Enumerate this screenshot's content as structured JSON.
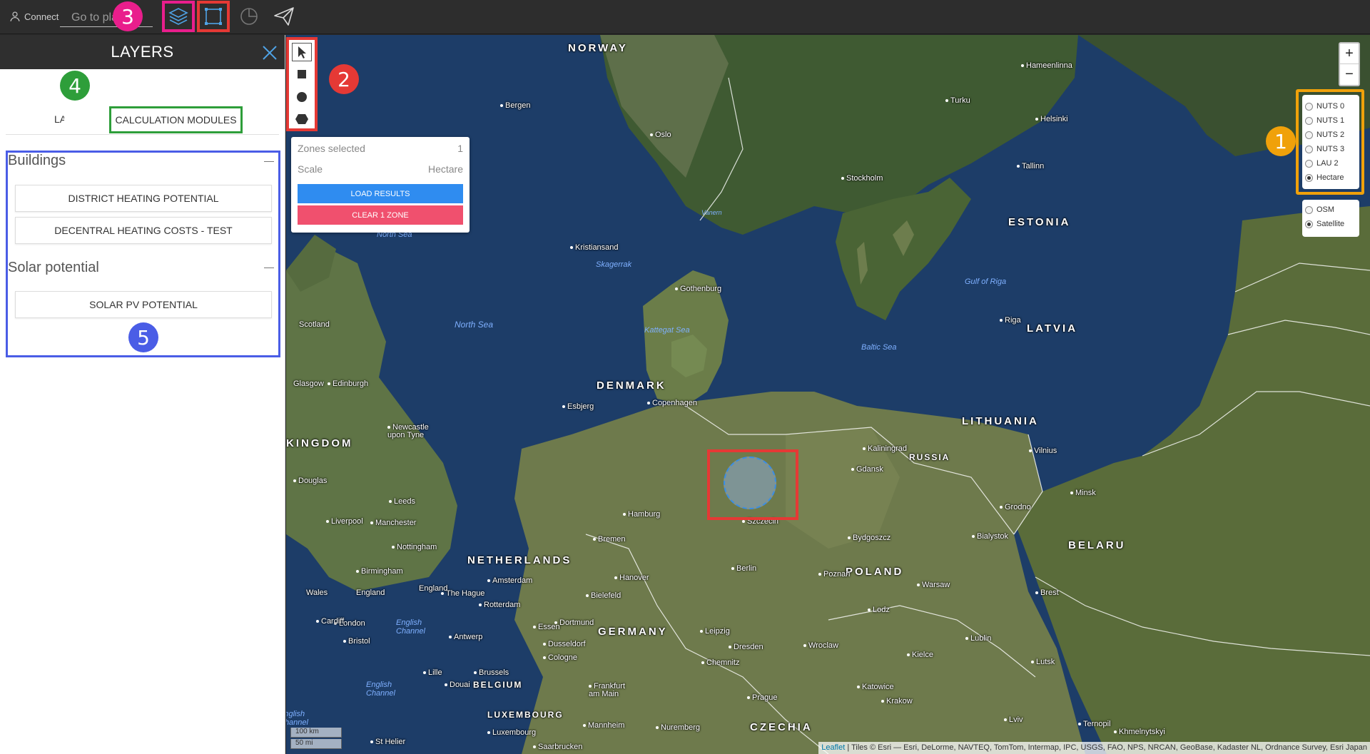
{
  "topbar": {
    "connect_label": "Connect",
    "goto_placeholder": "Go to place",
    "icons": [
      "user-icon",
      "layers-icon",
      "selection-icon",
      "pie-chart-icon",
      "send-icon"
    ]
  },
  "badges": {
    "one": "1",
    "two": "2",
    "three": "3",
    "four": "4",
    "five": "5"
  },
  "panel": {
    "title": "LAYERS",
    "tab_layers": "LAYERS",
    "tab_calc": "CALCULATION MODULES",
    "groups": [
      {
        "title": "Buildings",
        "modules": [
          "DISTRICT HEATING POTENTIAL",
          "DECENTRAL HEATING COSTS - TEST"
        ]
      },
      {
        "title": "Solar potential",
        "modules": [
          "SOLAR PV POTENTIAL"
        ]
      }
    ]
  },
  "selection": {
    "zones_label": "Zones selected",
    "zones_value": "1",
    "scale_label": "Scale",
    "scale_value": "Hectare",
    "load_btn": "LOAD RESULTS",
    "clear_btn": "CLEAR 1 ZONE"
  },
  "zoom": {
    "in": "+",
    "out": "−"
  },
  "levels": {
    "options": [
      "NUTS 0",
      "NUTS 1",
      "NUTS 2",
      "NUTS 3",
      "LAU 2",
      "Hectare"
    ],
    "selected": "Hectare"
  },
  "basemaps": {
    "options": [
      "OSM",
      "Satellite"
    ],
    "selected": "Satellite"
  },
  "scale": {
    "km": "100 km",
    "mi": "50 mi"
  },
  "attribution": {
    "leaflet": "Leaflet",
    "text": " | Tiles © Esri — Esri, DeLorme, NAVTEQ, TomTom, Intermap, IPC, USGS, FAO, NPS, NRCAN, GeoBase, Kadaster NL, Ordnance Survey, Esri Japan"
  },
  "map_labels": {
    "countries": [
      "NORWAY",
      "DENMARK",
      "NETHERLANDS",
      "GERMANY",
      "POLAND",
      "LITHUANIA",
      "LATVIA",
      "ESTONIA",
      "RUSSIA",
      "BELGIUM",
      "LUXEMBOURG",
      "CZECHIA",
      "BELARU",
      "KINGDOM"
    ],
    "seas": [
      "North Sea",
      "North Sea",
      "Skagerrak",
      "Kattegat Sea",
      "Baltic Sea",
      "Gulf of Riga",
      "Vanern",
      "English Channel",
      "English Channel",
      "English Channel"
    ],
    "cities": [
      "Bergen",
      "Oslo",
      "Stockholm",
      "Turku",
      "Helsinki",
      "Hameenlinna",
      "Tallinn",
      "Riga",
      "Kristiansand",
      "Gothenburg",
      "Copenhagen",
      "Esbjerg",
      "Hamburg",
      "Bremen",
      "Kaliningrad",
      "Gdansk",
      "Vilnius",
      "Minsk",
      "Grodno",
      "Bialystok",
      "Brest",
      "Szczecin",
      "Bydgoszcz",
      "Berlin",
      "Poznan",
      "Warsaw",
      "Lodz",
      "Lublin",
      "Kielce",
      "Lutsk",
      "Krakow",
      "Katowice",
      "Lviv",
      "Wroclaw",
      "Dresden",
      "Chemnitz",
      "Leipzig",
      "Hanover",
      "Bielefeld",
      "Dortmund",
      "Essen",
      "Dusseldorf",
      "Cologne",
      "Frankfurt am Main",
      "Mannheim",
      "Nuremberg",
      "Saarbrucken",
      "Prague",
      "Amsterdam",
      "The Hague",
      "Rotterdam",
      "Antwerp",
      "Brussels",
      "Lille",
      "Douai",
      "Luxembourg",
      "London",
      "Bristol",
      "Cardiff",
      "Wales",
      "England",
      "England",
      "Birmingham",
      "Nottingham",
      "Liverpool",
      "Manchester",
      "Leeds",
      "Douglas",
      "Newcastle upon Tyne",
      "Edinburgh",
      "Glasgow",
      "Scotland",
      "St Helier",
      "Ternopil",
      "Khmelnytskyi"
    ]
  }
}
